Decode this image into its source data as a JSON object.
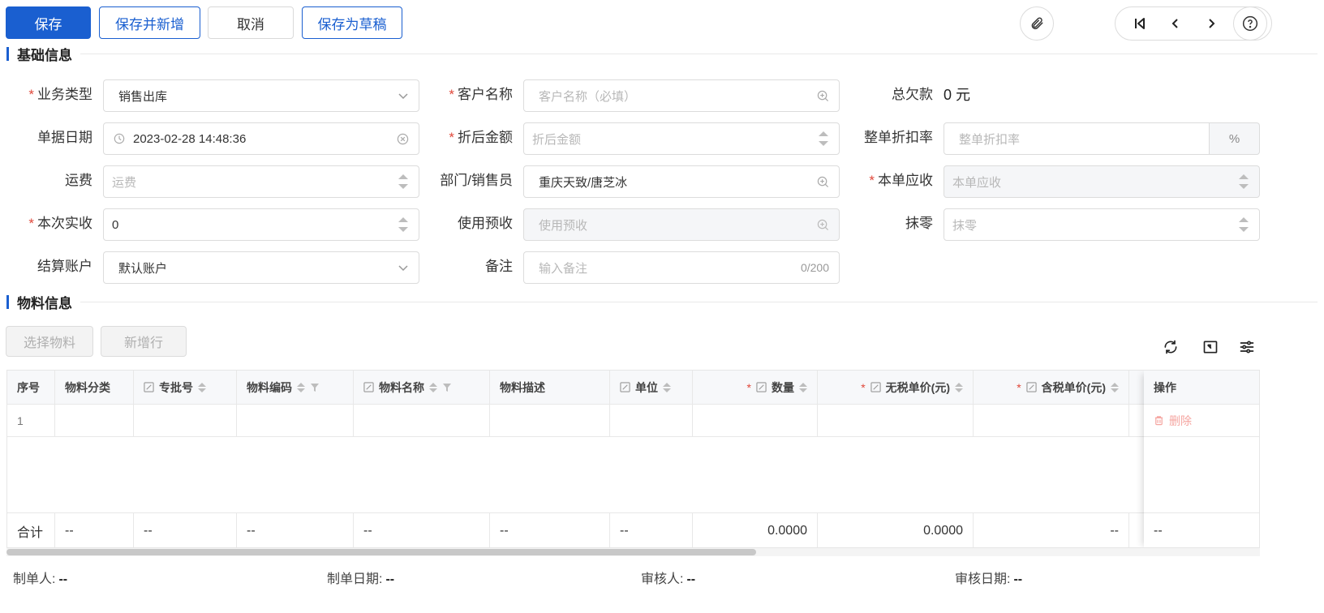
{
  "toolbar": {
    "save": "保存",
    "save_new": "保存并新增",
    "cancel": "取消",
    "save_draft": "保存为草稿"
  },
  "sections": {
    "basic": "基础信息",
    "material": "物料信息"
  },
  "form": {
    "business_type": {
      "label": "业务类型",
      "value": "销售出库"
    },
    "customer": {
      "label": "客户名称",
      "placeholder": "客户名称（必填）"
    },
    "total_debt": {
      "label": "总欠款",
      "value": "0 元"
    },
    "doc_date": {
      "label": "单据日期",
      "value": "2023-02-28 14:48:36"
    },
    "discounted_amount": {
      "label": "折后金额",
      "placeholder": "折后金额"
    },
    "discount_rate": {
      "label": "整单折扣率",
      "placeholder": "整单折扣率",
      "suffix": "%"
    },
    "freight": {
      "label": "运费",
      "placeholder": "运费"
    },
    "dept_sales": {
      "label": "部门/销售员",
      "value": "重庆天致/唐芝冰"
    },
    "receivable": {
      "label": "本单应收",
      "placeholder": "本单应收"
    },
    "actual_received": {
      "label": "本次实收",
      "value": "0"
    },
    "use_prepaid": {
      "label": "使用预收",
      "placeholder": "使用预收"
    },
    "rounding": {
      "label": "抹零",
      "placeholder": "抹零"
    },
    "account": {
      "label": "结算账户",
      "value": "默认账户"
    },
    "remark": {
      "label": "备注",
      "placeholder": "输入备注",
      "counter": "0/200"
    }
  },
  "material": {
    "select_btn": "选择物料",
    "add_row_btn": "新增行"
  },
  "table": {
    "columns": [
      "序号",
      "物料分类",
      "专批号",
      "物料编码",
      "物料名称",
      "物料描述",
      "单位",
      "数量",
      "无税单价(元)",
      "含税单价(元)"
    ],
    "op_column": "操作",
    "rows": [
      {
        "index": "1",
        "delete": "删除"
      }
    ],
    "summary_label": "合计",
    "summary": [
      "--",
      "--",
      "--",
      "--",
      "--",
      "--",
      "0.0000",
      "0.0000",
      "--",
      "--"
    ]
  },
  "footer": {
    "creator_label": "制单人:",
    "creator": "--",
    "created_label": "制单日期:",
    "created": "--",
    "reviewer_label": "审核人:",
    "reviewer": "--",
    "reviewed_label": "审核日期:",
    "reviewed": "--"
  },
  "colors": {
    "primary": "#1a5fd0",
    "required": "#e0483a",
    "delete": "#f5a5a0"
  }
}
